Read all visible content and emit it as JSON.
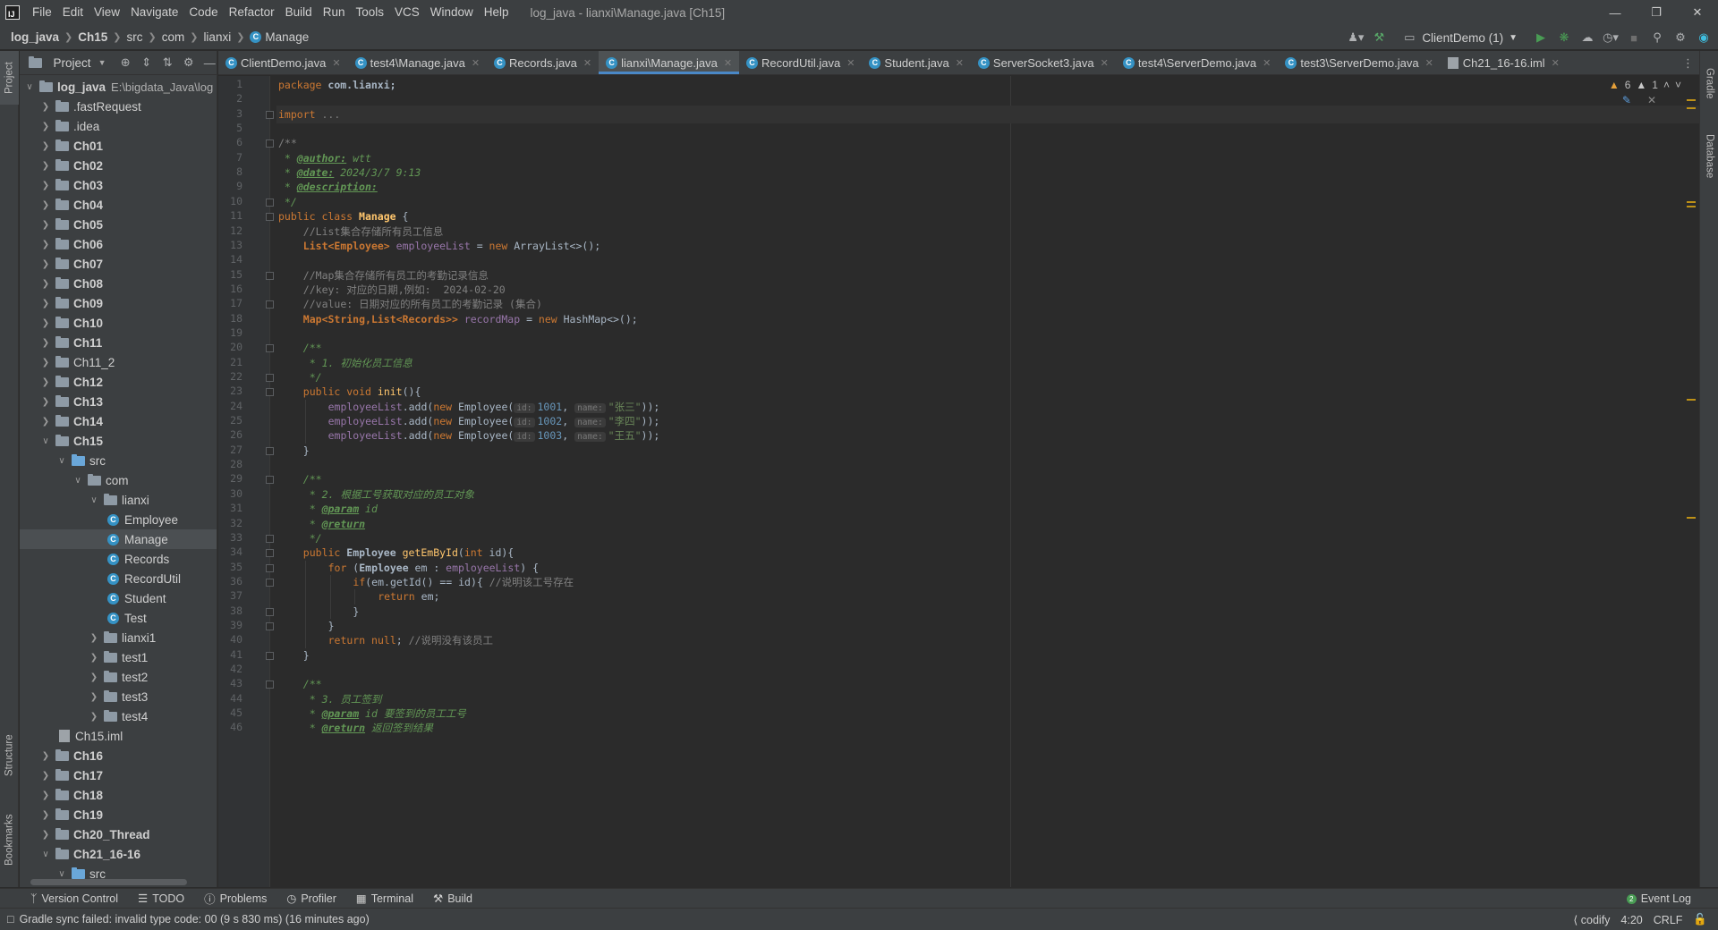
{
  "menu": [
    "File",
    "Edit",
    "View",
    "Navigate",
    "Code",
    "Refactor",
    "Build",
    "Run",
    "Tools",
    "VCS",
    "Window",
    "Help"
  ],
  "window_title": "log_java - lianxi\\Manage.java [Ch15]",
  "breadcrumb": [
    "log_java",
    "Ch15",
    "src",
    "com",
    "lianxi",
    "Manage"
  ],
  "run_config": "ClientDemo (1)",
  "project_panel": {
    "title": "Project",
    "tree": [
      {
        "label": "log_java",
        "path": "E:\\bigdata_Java\\log",
        "level": 0,
        "arrow": "down",
        "type": "folder",
        "bold": true
      },
      {
        "label": ".fastRequest",
        "level": 1,
        "arrow": "right",
        "type": "folder"
      },
      {
        "label": ".idea",
        "level": 1,
        "arrow": "right",
        "type": "folder"
      },
      {
        "label": "Ch01",
        "level": 1,
        "arrow": "right",
        "type": "folder",
        "bold": true
      },
      {
        "label": "Ch02",
        "level": 1,
        "arrow": "right",
        "type": "folder",
        "bold": true
      },
      {
        "label": "Ch03",
        "level": 1,
        "arrow": "right",
        "type": "folder",
        "bold": true
      },
      {
        "label": "Ch04",
        "level": 1,
        "arrow": "right",
        "type": "folder",
        "bold": true
      },
      {
        "label": "Ch05",
        "level": 1,
        "arrow": "right",
        "type": "folder",
        "bold": true
      },
      {
        "label": "Ch06",
        "level": 1,
        "arrow": "right",
        "type": "folder",
        "bold": true
      },
      {
        "label": "Ch07",
        "level": 1,
        "arrow": "right",
        "type": "folder",
        "bold": true
      },
      {
        "label": "Ch08",
        "level": 1,
        "arrow": "right",
        "type": "folder",
        "bold": true
      },
      {
        "label": "Ch09",
        "level": 1,
        "arrow": "right",
        "type": "folder",
        "bold": true
      },
      {
        "label": "Ch10",
        "level": 1,
        "arrow": "right",
        "type": "folder",
        "bold": true
      },
      {
        "label": "Ch11",
        "level": 1,
        "arrow": "right",
        "type": "folder",
        "bold": true
      },
      {
        "label": "Ch11_2",
        "level": 1,
        "arrow": "right",
        "type": "folder"
      },
      {
        "label": "Ch12",
        "level": 1,
        "arrow": "right",
        "type": "folder",
        "bold": true
      },
      {
        "label": "Ch13",
        "level": 1,
        "arrow": "right",
        "type": "folder",
        "bold": true
      },
      {
        "label": "Ch14",
        "level": 1,
        "arrow": "right",
        "type": "folder",
        "bold": true
      },
      {
        "label": "Ch15",
        "level": 1,
        "arrow": "down",
        "type": "folder",
        "bold": true
      },
      {
        "label": "src",
        "level": 2,
        "arrow": "down",
        "type": "folder-blue"
      },
      {
        "label": "com",
        "level": 3,
        "arrow": "down",
        "type": "folder"
      },
      {
        "label": "lianxi",
        "level": 4,
        "arrow": "down",
        "type": "folder"
      },
      {
        "label": "Employee",
        "level": 5,
        "arrow": "",
        "type": "class"
      },
      {
        "label": "Manage",
        "level": 5,
        "arrow": "",
        "type": "class",
        "selected": true
      },
      {
        "label": "Records",
        "level": 5,
        "arrow": "",
        "type": "class"
      },
      {
        "label": "RecordUtil",
        "level": 5,
        "arrow": "",
        "type": "class"
      },
      {
        "label": "Student",
        "level": 5,
        "arrow": "",
        "type": "class"
      },
      {
        "label": "Test",
        "level": 5,
        "arrow": "",
        "type": "class"
      },
      {
        "label": "lianxi1",
        "level": 4,
        "arrow": "right",
        "type": "folder"
      },
      {
        "label": "test1",
        "level": 4,
        "arrow": "right",
        "type": "folder"
      },
      {
        "label": "test2",
        "level": 4,
        "arrow": "right",
        "type": "folder"
      },
      {
        "label": "test3",
        "level": 4,
        "arrow": "right",
        "type": "folder"
      },
      {
        "label": "test4",
        "level": 4,
        "arrow": "right",
        "type": "folder"
      },
      {
        "label": "Ch15.iml",
        "level": 2,
        "arrow": "",
        "type": "file"
      },
      {
        "label": "Ch16",
        "level": 1,
        "arrow": "right",
        "type": "folder",
        "bold": true
      },
      {
        "label": "Ch17",
        "level": 1,
        "arrow": "right",
        "type": "folder",
        "bold": true
      },
      {
        "label": "Ch18",
        "level": 1,
        "arrow": "right",
        "type": "folder",
        "bold": true
      },
      {
        "label": "Ch19",
        "level": 1,
        "arrow": "right",
        "type": "folder",
        "bold": true
      },
      {
        "label": "Ch20_Thread",
        "level": 1,
        "arrow": "right",
        "type": "folder",
        "bold": true
      },
      {
        "label": "Ch21_16-16",
        "level": 1,
        "arrow": "down",
        "type": "folder",
        "bold": true
      },
      {
        "label": "src",
        "level": 2,
        "arrow": "down",
        "type": "folder-blue"
      }
    ]
  },
  "tabs": [
    {
      "label": "ClientDemo.java",
      "type": "class"
    },
    {
      "label": "test4\\Manage.java",
      "type": "class"
    },
    {
      "label": "Records.java",
      "type": "class"
    },
    {
      "label": "lianxi\\Manage.java",
      "type": "class",
      "active": true
    },
    {
      "label": "RecordUtil.java",
      "type": "class"
    },
    {
      "label": "Student.java",
      "type": "class"
    },
    {
      "label": "ServerSocket3.java",
      "type": "class"
    },
    {
      "label": "test4\\ServerDemo.java",
      "type": "class"
    },
    {
      "label": "test3\\ServerDemo.java",
      "type": "class"
    },
    {
      "label": "Ch21_16-16.iml",
      "type": "file"
    }
  ],
  "inspections": {
    "warnings": "6",
    "weak_warnings": "1"
  },
  "editor": {
    "line_numbers": [
      "1",
      "2",
      "3",
      "5",
      "6",
      "7",
      "8",
      "9",
      "10",
      "11",
      "12",
      "13",
      "14",
      "15",
      "16",
      "17",
      "18",
      "19",
      "20",
      "21",
      "22",
      "23",
      "24",
      "25",
      "26",
      "27",
      "28",
      "29",
      "30",
      "31",
      "32",
      "33",
      "34",
      "35",
      "36",
      "37",
      "38",
      "39",
      "40",
      "41",
      "42",
      "43",
      "44",
      "45",
      "46"
    ],
    "code": {
      "l1_kw": "package",
      "l1_pkg": "com.lianxi;",
      "l3_kw": "import",
      "l3_rest": "...",
      "l6": "/**",
      "l7_star": " * ",
      "l7_tag": "@author:",
      "l7_val": " wtt",
      "l8_star": " * ",
      "l8_tag": "@date:",
      "l8_val": " 2024/3/7 9:13",
      "l9_star": " * ",
      "l9_tag": "@description:",
      "l10": " */",
      "l11_kw": "public class ",
      "l11_name": "Manage",
      "l11_rest": " {",
      "l12": "//List集合存储所有员工信息",
      "l13_type": "List<Employee>",
      "l13_var": "employeeList",
      "l13_eq": " = ",
      "l13_new": "new ",
      "l13_rest": "ArrayList<>();",
      "l15": "//Map集合存储所有员工的考勤记录信息",
      "l16": "//key: 对应的日期,例如:  2024-02-20",
      "l17": "//value: 日期对应的所有员工的考勤记录 (集合)",
      "l18_type": "Map<String,List<Records>>",
      "l18_var": "recordMap",
      "l18_eq": " = ",
      "l18_new": "new ",
      "l18_rest": "HashMap<>();",
      "l20": "/**",
      "l21": " * 1. 初始化员工信息",
      "l22": " */",
      "l23_kw": "public void ",
      "l23_fn": "init",
      "l23_rest": "(){",
      "l24_a": "employeeList",
      "l24_b": ".add(",
      "l24_new": "new ",
      "l24_c": "Employee(",
      "l24_h1": "id:",
      "l24_n": "1001",
      "l24_h2": "name:",
      "l24_s": "\"张三\"",
      "l24_e": "));",
      "l25_a": "employeeList",
      "l25_b": ".add(",
      "l25_new": "new ",
      "l25_c": "Employee(",
      "l25_h1": "id:",
      "l25_n": "1002",
      "l25_h2": "name:",
      "l25_s": "\"李四\"",
      "l25_e": "));",
      "l26_a": "employeeList",
      "l26_b": ".add(",
      "l26_new": "new ",
      "l26_c": "Employee(",
      "l26_h1": "id:",
      "l26_n": "1003",
      "l26_h2": "name:",
      "l26_s": "\"王五\"",
      "l26_e": "));",
      "l27": "}",
      "l29": "/**",
      "l30": " * 2. 根据工号获取对应的员工对象",
      "l31_star": " * ",
      "l31_tag": "@param",
      "l31_val": " id",
      "l32_star": " * ",
      "l32_tag": "@return",
      "l33": " */",
      "l34_kw": "public ",
      "l34_type": "Employee ",
      "l34_fn": "getEmById",
      "l34_p": "(",
      "l34_int": "int ",
      "l34_rest": "id){",
      "l35_kw": "for ",
      "l35_a": "(",
      "l35_type": "Employee ",
      "l35_b": "em : ",
      "l35_var": "employeeList",
      "l35_c": ") {",
      "l36_kw": "if",
      "l36_a": "(em.getId() == id){ ",
      "l36_cm": "//说明该工号存在",
      "l37_kw": "return ",
      "l37_rest": "em;",
      "l38": "}",
      "l39": "}",
      "l40_kw": "return null",
      "l40_a": "; ",
      "l40_cm": "//说明没有该员工",
      "l41": "}",
      "l43": "/**",
      "l44": " * 3. 员工签到",
      "l45_star": " * ",
      "l45_tag": "@param",
      "l45_val": " id 要签到的员工工号",
      "l46_star": " * ",
      "l46_tag": "@return",
      "l46_val": " 返回签到结果"
    }
  },
  "bottom_tools": [
    "Version Control",
    "TODO",
    "Problems",
    "Profiler",
    "Terminal",
    "Build"
  ],
  "event_log": "Event Log",
  "event_log_badge": "2",
  "status_message": "Gradle sync failed: invalid type code: 00 (9 s 830 ms) (16 minutes ago)",
  "status_right": {
    "plugin": "codify",
    "position": "4:20",
    "line_sep": "CRLF"
  },
  "side_tabs": {
    "left_top": "Project",
    "left_structure": "Structure",
    "left_bookmarks": "Bookmarks",
    "right_gradle": "Gradle",
    "right_database": "Database"
  },
  "colors": {
    "accent": "#4a88c7",
    "keyword": "#cc7832",
    "string": "#6a8759",
    "number": "#6897bb",
    "field": "#9876aa",
    "method": "#ffc66d",
    "doc": "#629755"
  }
}
